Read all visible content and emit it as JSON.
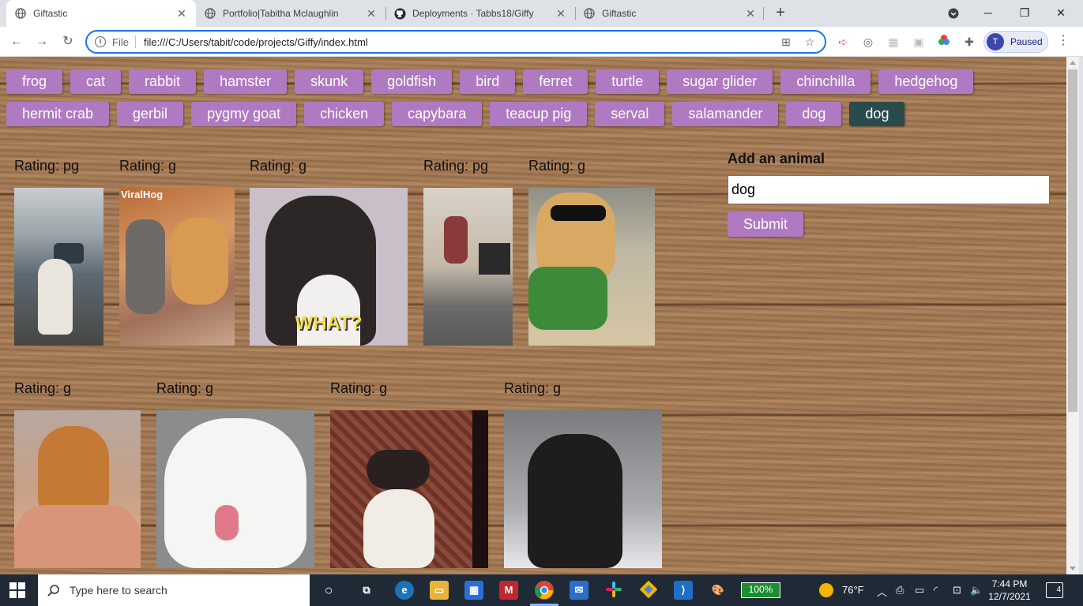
{
  "browser": {
    "tabs": [
      {
        "title": "Giftastic",
        "active": true
      },
      {
        "title": "Portfolio|Tabitha Mclaughlin",
        "active": false
      },
      {
        "title": "Deployments · Tabbs18/Giffy",
        "active": false
      },
      {
        "title": "Giftastic",
        "active": false
      }
    ],
    "omnibox": {
      "scheme_label": "File",
      "url": "file:///C:/Users/tabit/code/projects/Giffy/index.html"
    },
    "profile": {
      "initial": "T",
      "status": "Paused"
    }
  },
  "page": {
    "buttons_row1": [
      "frog",
      "cat",
      "rabbit",
      "hamster",
      "skunk",
      "goldfish",
      "bird",
      "ferret",
      "turtle",
      "sugar glider",
      "chinchilla",
      "hedgehog"
    ],
    "buttons_row2": [
      "hermit crab",
      "gerbil",
      "pygmy goat",
      "chicken",
      "capybara",
      "teacup pig",
      "serval",
      "salamander",
      "dog",
      "dog"
    ],
    "selected_button_index_row2": 9,
    "gifs": [
      {
        "rating": "Rating: pg",
        "description": "white dog on porch with car"
      },
      {
        "rating": "Rating: g",
        "description": "golden retriever and weimaraner on couch",
        "watermark": "ViralHog"
      },
      {
        "rating": "Rating: g",
        "description": "black and white dog",
        "caption": "WHAT?"
      },
      {
        "rating": "Rating: pg",
        "description": "dog in costume standing in room"
      },
      {
        "rating": "Rating: g",
        "description": "golden retriever with sunglasses driving"
      },
      {
        "rating": "Rating: g",
        "description": "puppy on its back"
      },
      {
        "rating": "Rating: g",
        "description": "smiling samoyed"
      },
      {
        "rating": "Rating: g",
        "description": "beagle puppy under blanket"
      },
      {
        "rating": "Rating: g",
        "description": "black dog looking up"
      }
    ],
    "form": {
      "label": "Add an animal",
      "input_value": "dog",
      "submit_label": "Submit"
    }
  },
  "taskbar": {
    "search_placeholder": "Type here to search",
    "battery": "100%",
    "temperature": "76°F",
    "time": "7:44 PM",
    "date": "12/7/2021",
    "notification_count": "4"
  },
  "colors": {
    "button_purple": "#b07ac2",
    "button_selected": "#2a4b4b",
    "omnibox_focus": "#1a73e8"
  }
}
